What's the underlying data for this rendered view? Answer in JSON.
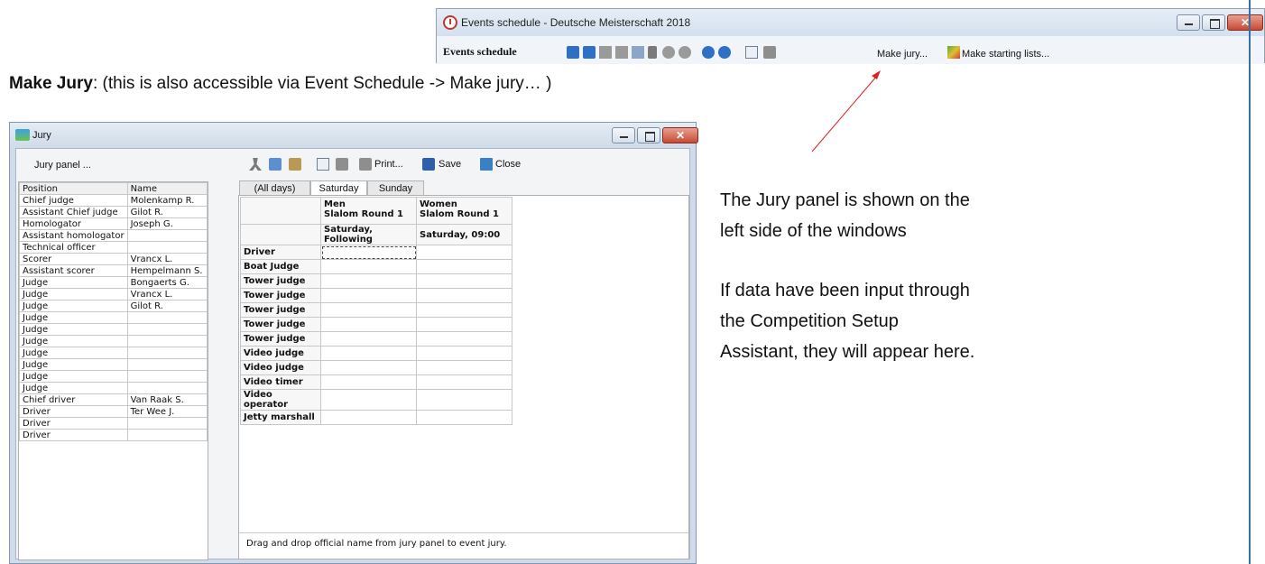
{
  "events_window": {
    "title": "Events schedule - Deutsche Meisterschaft 2018",
    "toolbar_label": "Events schedule",
    "make_jury": "Make jury...",
    "make_starting_lists": "Make starting lists..."
  },
  "heading": {
    "bold": "Make Jury",
    "rest": ": (this is also accessible via Event Schedule -> Make jury… )"
  },
  "description": {
    "line1": "The Jury panel is shown on the",
    "line2": "left side of the windows",
    "line3": "If data have been input through",
    "line4": "the Competition Setup",
    "line5": "Assistant, they will appear here."
  },
  "jury_window": {
    "title": "Jury",
    "panel_label": "Jury panel ...",
    "toolbar": {
      "print": "Print...",
      "save": "Save",
      "close": "Close"
    },
    "tabs": [
      "(All days)",
      "Saturday",
      "Sunday"
    ],
    "active_tab": "Saturday",
    "panel_headers": [
      "Position",
      "Name"
    ],
    "panel_rows": [
      [
        "Chief judge",
        "Molenkamp R."
      ],
      [
        "Assistant Chief judge",
        "Gilot R."
      ],
      [
        "Homologator",
        "Joseph G."
      ],
      [
        "Assistant homologator",
        ""
      ],
      [
        "Technical officer",
        ""
      ],
      [
        "Scorer",
        "Vrancx L."
      ],
      [
        "Assistant scorer",
        "Hempelmann S."
      ],
      [
        "Judge",
        "Bongaerts G."
      ],
      [
        "Judge",
        "Vrancx L."
      ],
      [
        "Judge",
        "Gilot R."
      ],
      [
        "Judge",
        ""
      ],
      [
        "Judge",
        ""
      ],
      [
        "Judge",
        ""
      ],
      [
        "Judge",
        ""
      ],
      [
        "Judge",
        ""
      ],
      [
        "Judge",
        ""
      ],
      [
        "Judge",
        ""
      ],
      [
        "Chief driver",
        "Van Raak S."
      ],
      [
        "Driver",
        "Ter Wee J."
      ],
      [
        "Driver",
        ""
      ],
      [
        "Driver",
        ""
      ]
    ],
    "events": [
      {
        "line1": "Men",
        "line2": "Slalom Round 1",
        "time": "Saturday, Following"
      },
      {
        "line1": "Women",
        "line2": "Slalom Round 1",
        "time": "Saturday, 09:00"
      }
    ],
    "roles": [
      "Driver",
      "Boat Judge",
      "Tower judge",
      "Tower judge",
      "Tower judge",
      "Tower judge",
      "Tower judge",
      "Video judge",
      "Video judge",
      "Video timer",
      "Video operator",
      "Jetty marshall"
    ],
    "hint": "Drag and drop official name from jury panel to event jury."
  }
}
